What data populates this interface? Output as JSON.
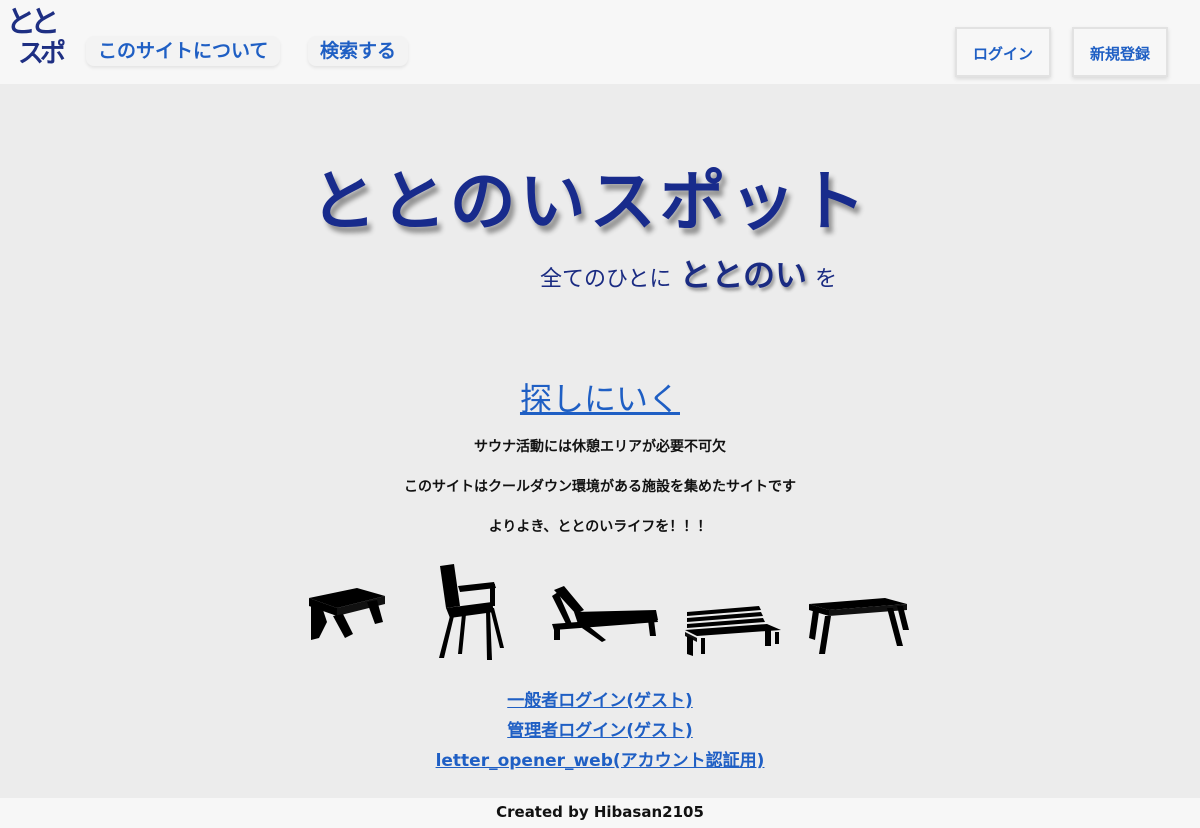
{
  "nav": {
    "logo_line1": "とと",
    "logo_line2": "スポ",
    "about_label": "このサイトについて",
    "search_label": "検索する",
    "login_label": "ログイン",
    "register_label": "新規登録"
  },
  "hero": {
    "title": "ととのいスポット",
    "tagline_pre": "全てのひとに",
    "tagline_mid": "ととのい",
    "tagline_post": "を"
  },
  "main": {
    "search_link": "探しにいく",
    "desc_lines": [
      "サウナ活動には休憩エリアが必要不可欠",
      "このサイトはクールダウン環境がある施設を集めたサイトです",
      "よりよき、ととのいライフを！！！"
    ],
    "furniture_icons": [
      "stool-icon",
      "armchair-icon",
      "lounger-icon",
      "bench-icon",
      "table-bench-icon"
    ],
    "guest_login": "一般者ログイン(ゲスト)",
    "admin_login": "管理者ログイン(ゲスト)",
    "letter_opener": "letter_opener_web(アカウント認証用)"
  },
  "footer": {
    "credit": "Created by Hibasan2105"
  },
  "colors": {
    "link": "#1f5fc4",
    "title": "#182b8c",
    "background": "#ececec",
    "navbar": "#f7f7f7"
  }
}
